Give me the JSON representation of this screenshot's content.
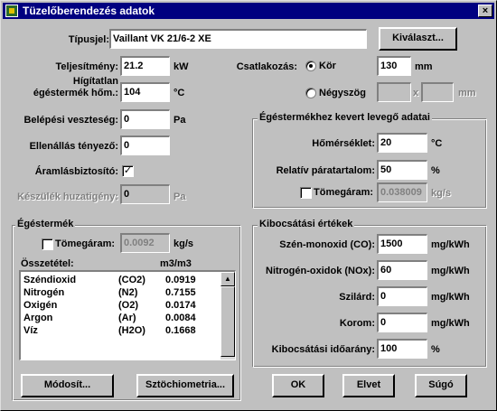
{
  "window": {
    "title": "Tüzelőberendezés adatok",
    "close": "×"
  },
  "tipusjel": {
    "label": "Típusjel:",
    "value": "Vaillant VK 21/6-2 XE",
    "select_button": "Kiválaszt..."
  },
  "teljesitmeny": {
    "label": "Teljesítmény:",
    "value": "21.2",
    "unit": "kW"
  },
  "higitatlan": {
    "label_line1": "Hígítatlan",
    "label_line2": "égéstermék hőm.:",
    "value": "104",
    "unit": "°C"
  },
  "csatlakozas": {
    "label": "Csatlakozás:",
    "kor": {
      "label": "Kör",
      "selected": true,
      "value": "130",
      "unit": "mm"
    },
    "negyszog": {
      "label": "Négyszög",
      "selected": false,
      "value1": "",
      "sep": "x",
      "value2": "",
      "unit": "mm"
    }
  },
  "belepesi": {
    "label": "Belépési veszteség:",
    "value": "0",
    "unit": "Pa"
  },
  "ellenallas": {
    "label": "Ellenállás tényező:",
    "value": "0"
  },
  "aramlas": {
    "label": "Áramlásbiztosító:",
    "checked": true,
    "mark": "✓"
  },
  "keszulek": {
    "label": "Készülék huzatigény:",
    "value": "0",
    "unit": "Pa"
  },
  "levego": {
    "title": "Égéstermékhez kevert levegő adatai",
    "homerseklet": {
      "label": "Hőmérséklet:",
      "value": "20",
      "unit": "°C"
    },
    "paratartalom": {
      "label": "Relatív páratartalom:",
      "value": "50",
      "unit": "%"
    },
    "tomegaram": {
      "label": "Tömegáram:",
      "checked": false,
      "value": "0.038009",
      "unit": "kg/s"
    }
  },
  "egestermek": {
    "title": "Égéstermék",
    "tomegaram": {
      "label": "Tömegáram:",
      "checked": false,
      "value": "0.0092",
      "unit": "kg/s"
    },
    "osszetetel_label": "Összetétel:",
    "unit_header": "m3/m3",
    "rows": [
      {
        "name": "Széndioxid",
        "formula": "(CO2)",
        "value": "0.0919"
      },
      {
        "name": "Nitrogén",
        "formula": "(N2)",
        "value": "0.7155"
      },
      {
        "name": "Oxigén",
        "formula": "(O2)",
        "value": "0.0174"
      },
      {
        "name": "Argon",
        "formula": "(Ar)",
        "value": "0.0084"
      },
      {
        "name": "Víz",
        "formula": "(H2O)",
        "value": "0.1668"
      }
    ],
    "modosit_button": "Módosít...",
    "sztochiometria_button": "Sztöchiometria..."
  },
  "kibocsatasi": {
    "title": "Kibocsátási értékek",
    "co": {
      "label": "Szén-monoxid (CO):",
      "value": "1500",
      "unit": "mg/kWh"
    },
    "nox": {
      "label": "Nitrogén-oxidok (NOx):",
      "value": "60",
      "unit": "mg/kWh"
    },
    "szilard": {
      "label": "Szilárd:",
      "value": "0",
      "unit": "mg/kWh"
    },
    "korom": {
      "label": "Korom:",
      "value": "0",
      "unit": "mg/kWh"
    },
    "idoarany": {
      "label": "Kibocsátási időarány:",
      "value": "100",
      "unit": "%"
    }
  },
  "buttons": {
    "ok": "OK",
    "elvet": "Elvet",
    "sugo": "Súgó"
  }
}
